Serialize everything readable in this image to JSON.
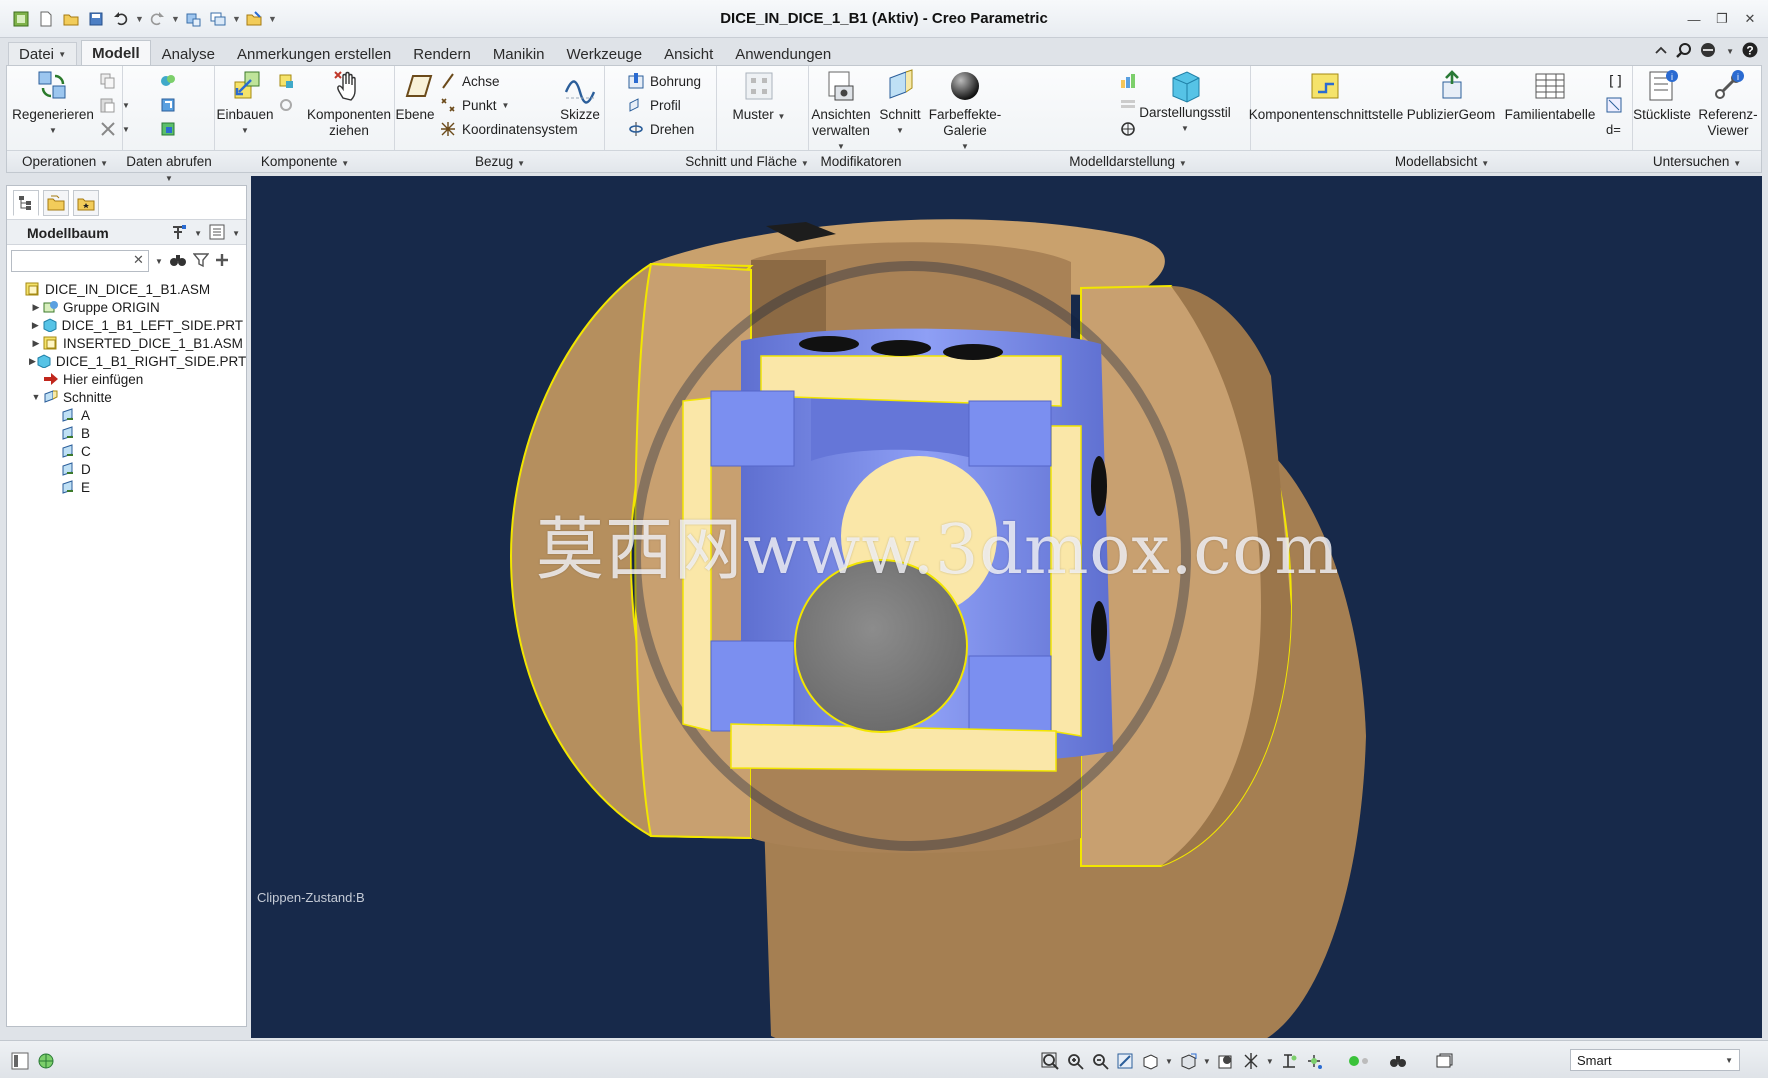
{
  "app": {
    "title": "DICE_IN_DICE_1_B1 (Aktiv) - Creo Parametric"
  },
  "tabs": [
    {
      "label": "Datei",
      "type": "file"
    },
    {
      "label": "Modell",
      "active": true
    },
    {
      "label": "Analyse"
    },
    {
      "label": "Anmerkungen erstellen"
    },
    {
      "label": "Rendern"
    },
    {
      "label": "Manikin"
    },
    {
      "label": "Werkzeuge"
    },
    {
      "label": "Ansicht"
    },
    {
      "label": "Anwendungen"
    }
  ],
  "ribbon": {
    "regenerate": "Regenerieren",
    "install": "Einbauen",
    "drag_components": "Komponenten ziehen",
    "plane": "Ebene",
    "axis": "Achse",
    "point": "Punkt",
    "csys": "Koordinatensystem",
    "sketch": "Skizze",
    "hole": "Bohrung",
    "profile": "Profil",
    "revolve": "Drehen",
    "pattern": "Muster",
    "manage_views": "Ansichten verwalten",
    "section": "Schnitt",
    "appearance_gallery": "Farbeffekte-Galerie",
    "display_style": "Darstellungsstil",
    "component_interface": "Komponentenschnittstelle",
    "publish_geom": "PublizierGeom",
    "family_table": "Familientabelle",
    "bom": "Stückliste",
    "reference_viewer": "Referenz-Viewer"
  },
  "groups": [
    "Operationen",
    "Daten abrufen",
    "Komponente",
    "Bezug",
    "Schnitt und Fläche",
    "Modifikatoren",
    "Modelldarstellung",
    "Modellabsicht",
    "Untersuchen"
  ],
  "model_tree": {
    "title": "Modellbaum",
    "search_placeholder": "",
    "items": [
      {
        "label": "DICE_IN_DICE_1_B1.ASM",
        "level": 0,
        "toggle": "",
        "icon": "assembly-icon"
      },
      {
        "label": "Gruppe ORIGIN",
        "level": 1,
        "toggle": "▶",
        "icon": "group-icon"
      },
      {
        "label": "DICE_1_B1_LEFT_SIDE.PRT",
        "level": 1,
        "toggle": "▶",
        "icon": "part-icon"
      },
      {
        "label": "INSERTED_DICE_1_B1.ASM",
        "level": 1,
        "toggle": "▶",
        "icon": "assembly-icon"
      },
      {
        "label": "DICE_1_B1_RIGHT_SIDE.PRT",
        "level": 1,
        "toggle": "▶",
        "icon": "part-icon"
      },
      {
        "label": "Hier einfügen",
        "level": 1,
        "toggle": "",
        "icon": "insert-here-icon"
      },
      {
        "label": "Schnitte",
        "level": 1,
        "toggle": "▼",
        "icon": "sections-folder-icon"
      },
      {
        "label": "A",
        "level": 2,
        "toggle": "",
        "icon": "section-icon"
      },
      {
        "label": "B",
        "level": 2,
        "toggle": "",
        "icon": "section-icon"
      },
      {
        "label": "C",
        "level": 2,
        "toggle": "",
        "icon": "section-icon"
      },
      {
        "label": "D",
        "level": 2,
        "toggle": "",
        "icon": "section-icon"
      },
      {
        "label": "E",
        "level": 2,
        "toggle": "",
        "icon": "section-icon"
      }
    ]
  },
  "viewport": {
    "watermark": "莫西网www.3dmox.com",
    "clip_state": "Clippen-Zustand:B",
    "background": "#17294a"
  },
  "statusbar": {
    "selection_filter": "Smart"
  },
  "colors": {
    "wood": "#c8a070",
    "wood_dark": "#8c6a44",
    "cut_face": "#fae7a8",
    "inner_blue": "#7b8ff0",
    "ball": "#7f7f7f",
    "highlight": "#f2e600"
  }
}
